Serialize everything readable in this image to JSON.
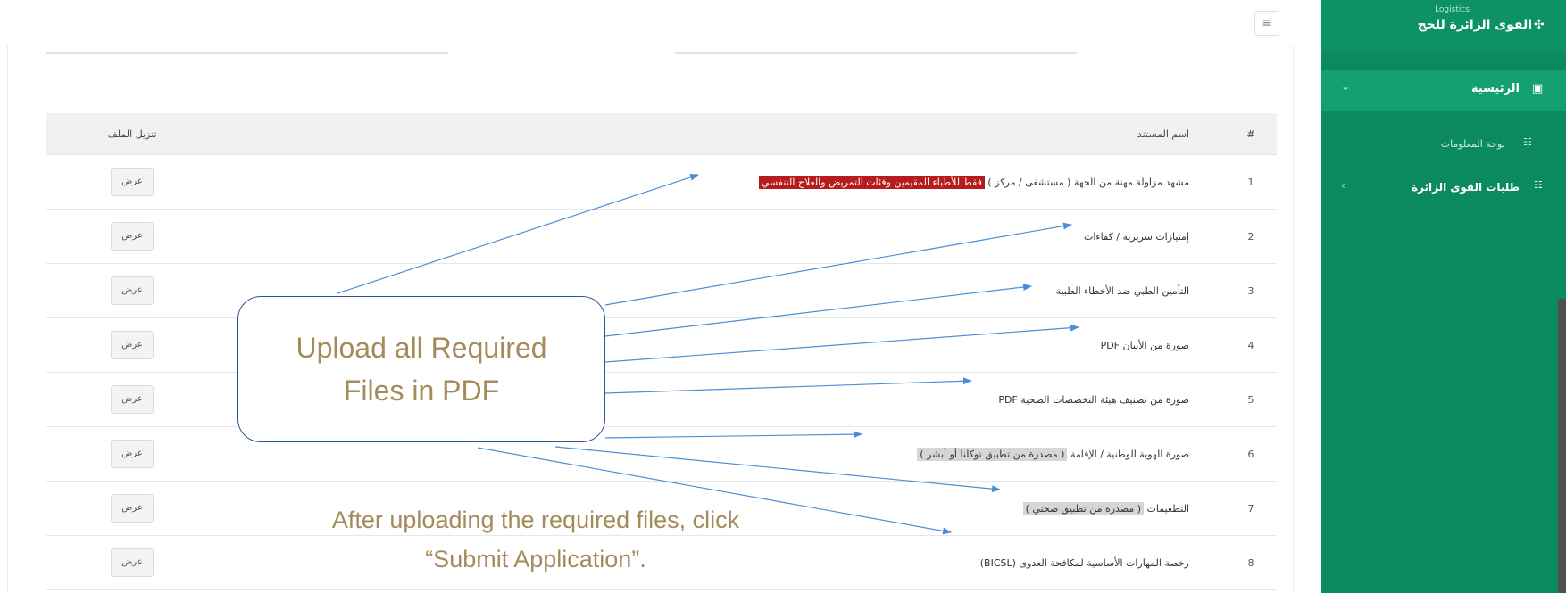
{
  "colors": {
    "sidebar": "#0b8a5f",
    "sidebar_active": "#14a06e",
    "annotation_text": "#a58a5a",
    "annotation_line": "#4a8fd6",
    "highlight_red": "#b71c1c"
  },
  "sidebar": {
    "brand_small": "Logistics",
    "brand": "القوى الزائرة للحج",
    "brand_icon": "people-icon",
    "home_label": "الرئيسية",
    "dashboard_label": "لوحة المعلومات",
    "requests_label": "طلبات القوى الزائرة"
  },
  "table": {
    "header_num": "#",
    "header_name": "اسم المستند",
    "header_action": "تنزيل الملف",
    "view_label": "عرض",
    "rows": [
      {
        "num": "1",
        "name": "مشهد مزاولة مهنة من الجهة ( مستشفى / مركز )",
        "highlight": "فقط للأطباء المقيمين وفئات التمريض والعلاج التنفسي"
      },
      {
        "num": "2",
        "name": "إمتيازات سريرية / كفاءات"
      },
      {
        "num": "3",
        "name": "التأمين الطبي ضد الأخطاء الطبية"
      },
      {
        "num": "4",
        "name": "صورة من الأيبان PDF"
      },
      {
        "num": "5",
        "name": "صورة من تصنيف هيئة التخصصات الصحية PDF"
      },
      {
        "num": "6",
        "name": "صورة الهوية الوطنية / الإقامة",
        "highlight": "( مصدرة من تطبيق توكلنا أو أبشر )"
      },
      {
        "num": "7",
        "name": "التطعيمات",
        "highlight": "( مصدرة من تطبيق صحتي )"
      },
      {
        "num": "8",
        "name": "رخصة المهارات الأساسية لمكافحة العدوى (BICSL)"
      }
    ]
  },
  "callout": {
    "line1": "Upload all Required",
    "line2": "Files in PDF"
  },
  "instruction": {
    "line1": "After uploading the required files, click",
    "line2": "“Submit Application”."
  }
}
